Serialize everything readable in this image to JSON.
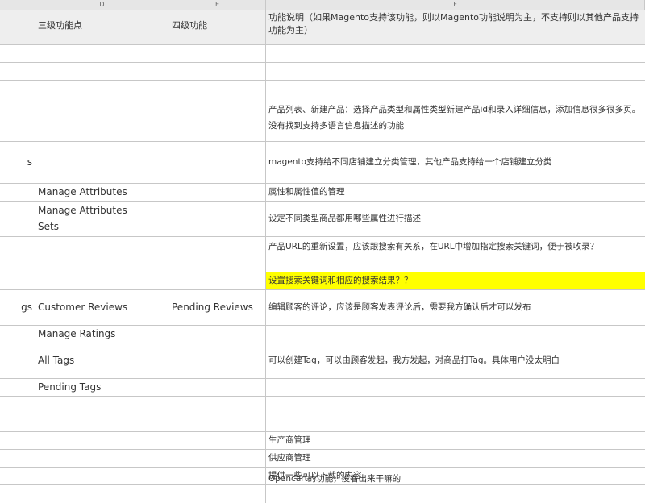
{
  "columns": [
    {
      "letter": ""
    },
    {
      "letter": "D"
    },
    {
      "letter": "E"
    },
    {
      "letter": "F"
    }
  ],
  "header": {
    "level3": "三级功能点",
    "level4": "四级功能",
    "desc": "功能说明（如果Magento支持该功能，则以Magento功能说明为主，不支持则以其他产品支持功能为主）"
  },
  "rows": [
    {
      "a": "",
      "d": "",
      "e": "",
      "f": ""
    },
    {
      "a": "",
      "d": "",
      "e": "",
      "f": ""
    },
    {
      "a": "",
      "d": "",
      "e": "",
      "f": ""
    },
    {
      "a": "",
      "d": "",
      "e": "",
      "f": "产品列表、新建产品：选择产品类型和属性类型新建产品id和录入详细信息，添加信息很多很多页。没有找到支持多语言信息描述的功能"
    },
    {
      "a": "s",
      "d": "",
      "e": "",
      "f": "magento支持给不同店铺建立分类管理，其他产品支持给一个店铺建立分类"
    },
    {
      "a": "",
      "d": "Manage Attributes",
      "e": "",
      "f": "属性和属性值的管理"
    },
    {
      "a": "",
      "d": "Manage Attributes Sets",
      "e": "",
      "f": "设定不同类型商品都用哪些属性进行描述"
    },
    {
      "a": "",
      "d": "",
      "e": "",
      "f": "产品URL的重新设置，应该跟搜索有关系，在URL中增加指定搜索关键词，便于被收录？"
    },
    {
      "a": "",
      "d": "",
      "e": "",
      "f": "设置搜索关键词和相应的搜索结果？？"
    },
    {
      "a": "gs",
      "d": "Customer Reviews",
      "e": "Pending Reviews",
      "f": "编辑顾客的评论，应该是顾客发表评论后，需要我方确认后才可以发布"
    },
    {
      "a": "",
      "d": "Manage Ratings",
      "e": "",
      "f": ""
    },
    {
      "a": "",
      "d": "All Tags",
      "e": "",
      "f": "可以创建Tag，可以由顾客发起，我方发起，对商品打Tag。具体用户没太明白"
    },
    {
      "a": "",
      "d": "Pending Tags",
      "e": "",
      "f": ""
    },
    {
      "a": "",
      "d": "",
      "e": "",
      "f": ""
    },
    {
      "a": "",
      "d": "",
      "e": "",
      "f": ""
    },
    {
      "a": "",
      "d": "",
      "e": "",
      "f": "生产商管理"
    },
    {
      "a": "",
      "d": "",
      "e": "",
      "f": "供应商管理"
    },
    {
      "a": "",
      "d": "",
      "e": "",
      "f": "提供一些可以下载的内容"
    },
    {
      "a": "",
      "d": "",
      "e": "",
      "f": "Opencart的功能，没看出来干嘛的"
    }
  ],
  "colors": {
    "highlight": "#ffff00",
    "grid": "#c7c7c7",
    "header_bg": "#e6e6e6"
  }
}
